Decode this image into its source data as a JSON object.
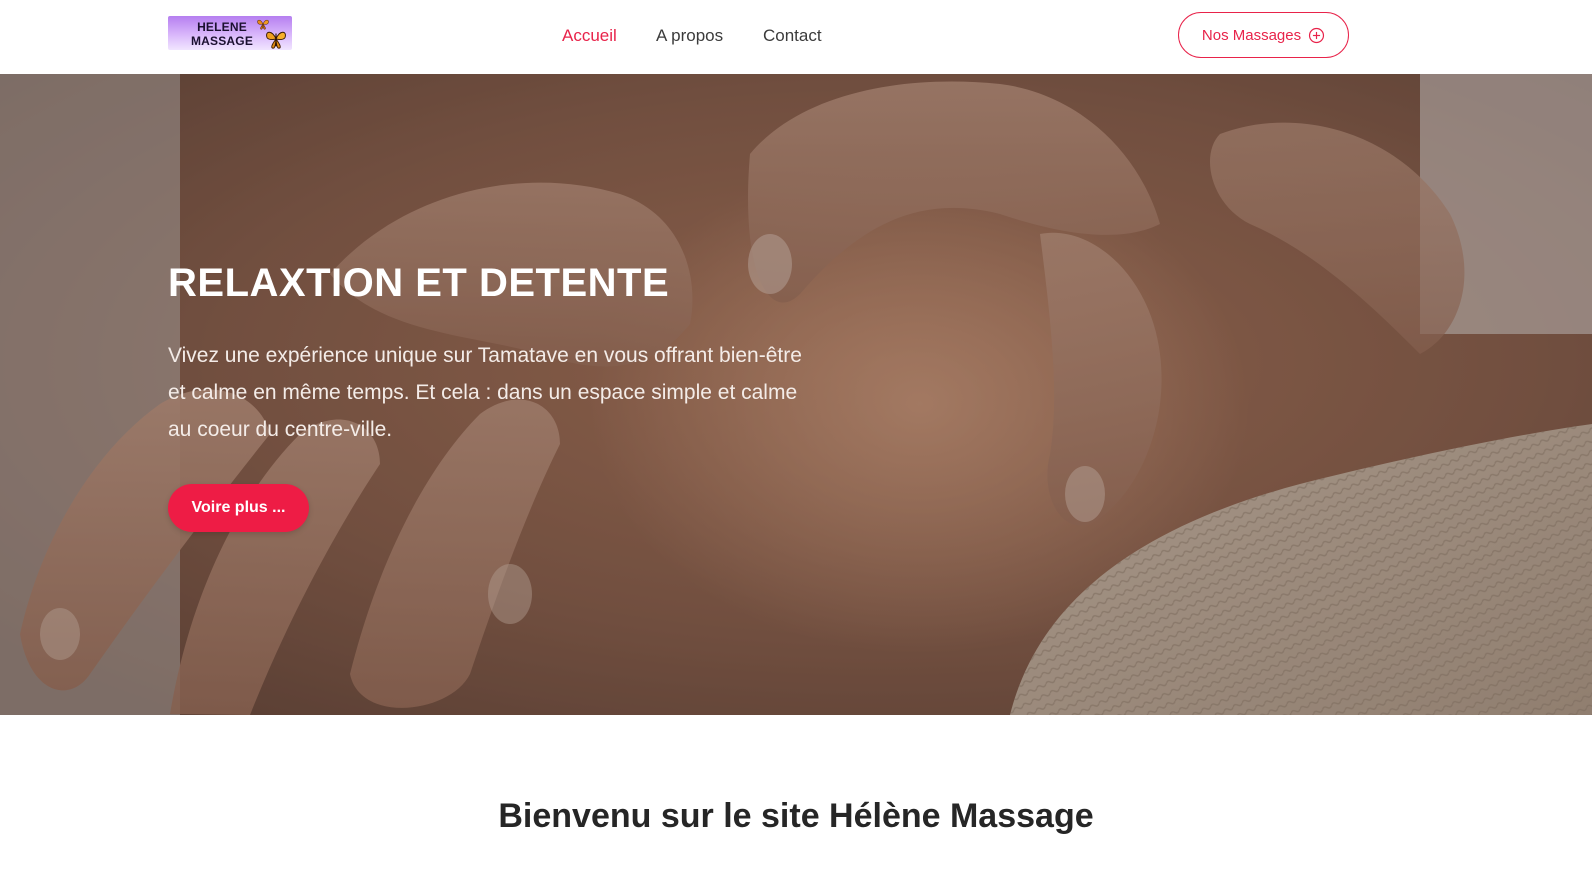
{
  "brand": {
    "logo_line1": "HELENE",
    "logo_line2": "MASSAGE",
    "logo_icon": "butterfly-icon"
  },
  "nav": {
    "items": [
      {
        "label": "Accueil",
        "active": true
      },
      {
        "label": "A propos",
        "active": false
      },
      {
        "label": "Contact",
        "active": false
      }
    ],
    "cta_label": "Nos Massages",
    "cta_icon": "plus-circle-icon"
  },
  "hero": {
    "title": "RELAXTION ET DETENTE",
    "text": "Vivez une expérience unique sur Tamatave en vous offrant bien-être et calme en même temps. Et cela : dans un espace simple et calme au coeur du centre-ville.",
    "button_label": "Voire plus ..."
  },
  "welcome": {
    "title": "Bienvenu sur le site Hélène Massage"
  },
  "colors": {
    "accent": "#e8234a",
    "button": "#ee1c45",
    "text": "#3b3b3b"
  }
}
